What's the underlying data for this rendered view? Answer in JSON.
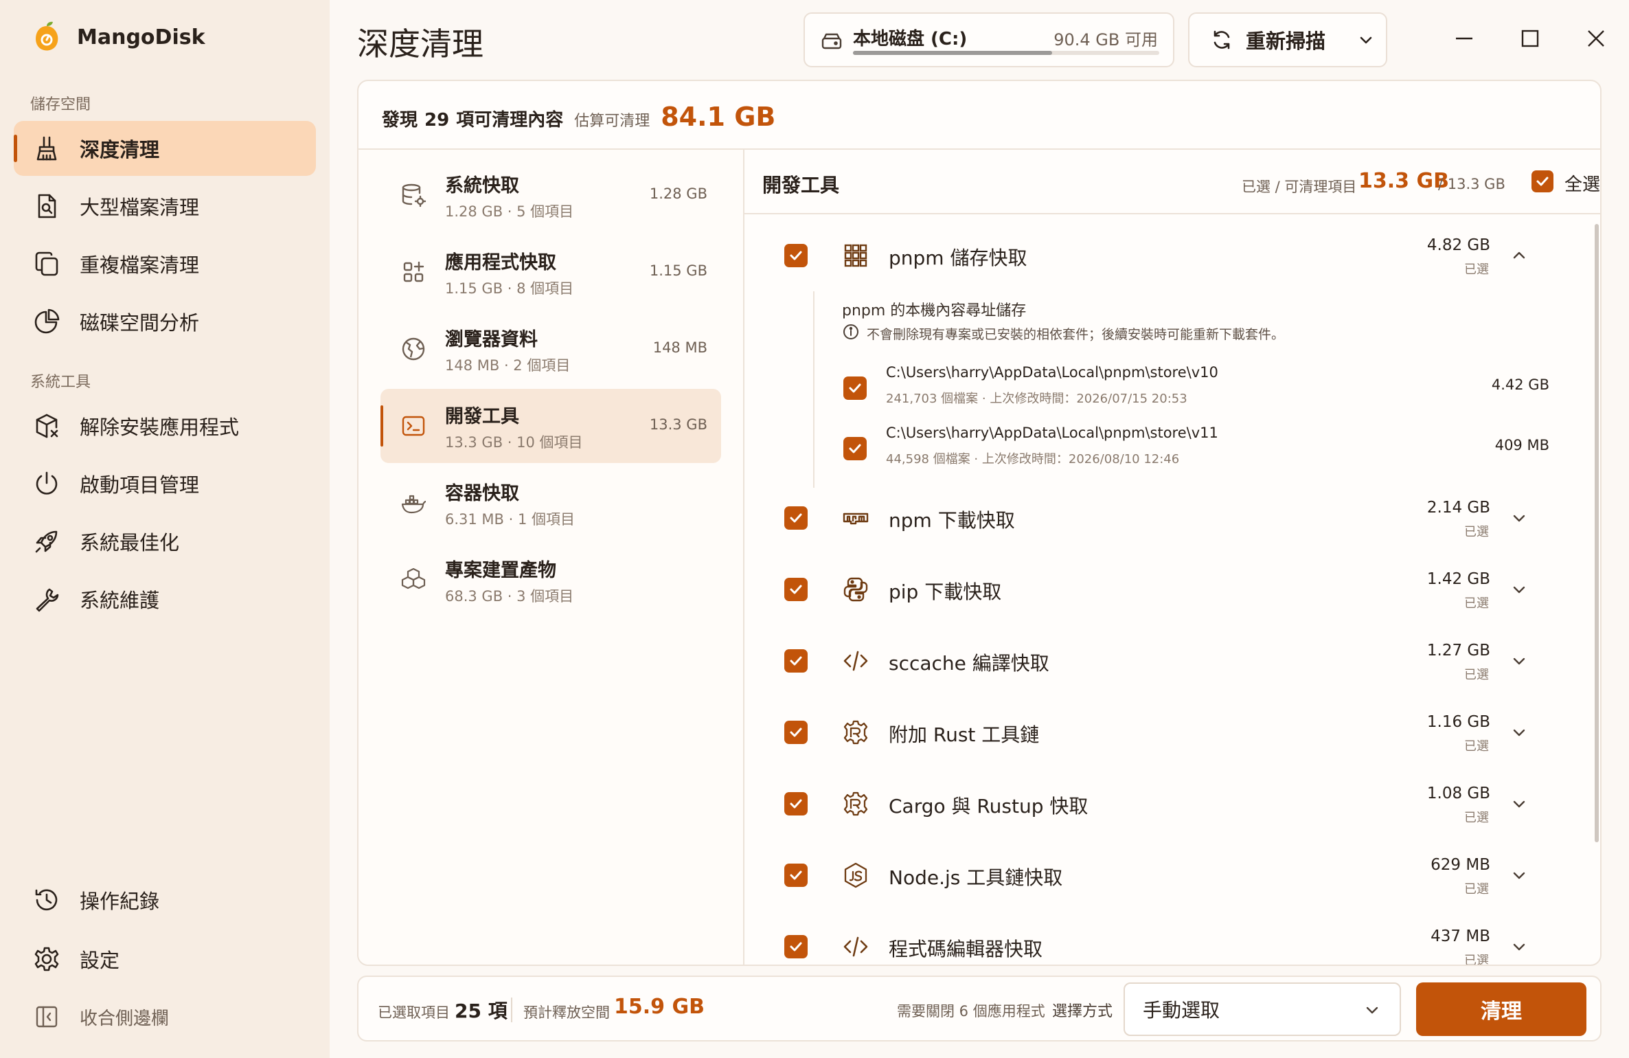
{
  "app": {
    "name": "MangoDisk"
  },
  "sidebar": {
    "section_storage": "儲存空間",
    "section_tools": "系統工具",
    "items": [
      {
        "label": "深度清理",
        "icon": "broom-icon",
        "active": true
      },
      {
        "label": "大型檔案清理",
        "icon": "file-search-icon"
      },
      {
        "label": "重複檔案清理",
        "icon": "copy-icon"
      },
      {
        "label": "磁碟空間分析",
        "icon": "pie-chart-icon"
      },
      {
        "label": "解除安裝應用程式",
        "icon": "package-remove-icon"
      },
      {
        "label": "啟動項目管理",
        "icon": "power-icon"
      },
      {
        "label": "系統最佳化",
        "icon": "rocket-icon"
      },
      {
        "label": "系統維護",
        "icon": "wrench-icon"
      }
    ],
    "bottom": [
      {
        "label": "操作紀錄",
        "icon": "history-icon"
      },
      {
        "label": "設定",
        "icon": "gear-icon"
      },
      {
        "label": "收合側邊欄",
        "icon": "collapse-sidebar-icon"
      }
    ]
  },
  "header": {
    "title": "深度清理",
    "disk_label": "本地磁盘 (C:)",
    "disk_free": "90.4 GB 可用",
    "disk_used_fraction": 0.65,
    "rescan_label": "重新掃描"
  },
  "summary": {
    "found_prefix": "發現",
    "found_count": "29",
    "found_suffix": "項可清理內容",
    "estimate_label": "估算可清理",
    "estimate_value": "84.1 GB"
  },
  "categories": [
    {
      "name": "系統快取",
      "sub": "1.28 GB · 5 個項目",
      "size": "1.28 GB",
      "icon": "database-gear-icon"
    },
    {
      "name": "應用程式快取",
      "sub": "1.15 GB · 8 個項目",
      "size": "1.15 GB",
      "icon": "apps-add-icon"
    },
    {
      "name": "瀏覽器資料",
      "sub": "148 MB · 2 個項目",
      "size": "148 MB",
      "icon": "globe-icon"
    },
    {
      "name": "開發工具",
      "sub": "13.3 GB · 10 個項目",
      "size": "13.3 GB",
      "icon": "terminal-icon",
      "active": true
    },
    {
      "name": "容器快取",
      "sub": "6.31 MB · 1 個項目",
      "size": "",
      "icon": "docker-icon"
    },
    {
      "name": "專案建置產物",
      "sub": "68.3 GB · 3 個項目",
      "size": "",
      "icon": "cubes-icon"
    }
  ],
  "detail": {
    "title": "開發工具",
    "selected_label": "已選 / 可清理項目",
    "selected_value": "13.3 GB",
    "total_value": "/ 13.3 GB",
    "select_all_label": "全選",
    "selected_tag": "已選",
    "expanded": {
      "name": "pnpm 儲存快取",
      "size": "4.82 GB",
      "desc": "pnpm 的本機內容尋址儲存",
      "note": "不會刪除現有專案或已安裝的相依套件；後續安裝時可能重新下載套件。",
      "paths": [
        {
          "path": "C:\\Users\\harry\\AppData\\Local\\pnpm\\store\\v10",
          "meta": "241,703 個檔案 · 上次修改時間：2026/07/15 20:53",
          "size": "4.42 GB"
        },
        {
          "path": "C:\\Users\\harry\\AppData\\Local\\pnpm\\store\\v11",
          "meta": "44,598 個檔案 · 上次修改時間：2026/08/10 12:46",
          "size": "409 MB"
        }
      ]
    },
    "rows": [
      {
        "name": "npm 下載快取",
        "size": "2.14 GB",
        "icon": "npm-icon"
      },
      {
        "name": "pip 下載快取",
        "size": "1.42 GB",
        "icon": "python-icon"
      },
      {
        "name": "sccache 編譯快取",
        "size": "1.27 GB",
        "icon": "code-icon"
      },
      {
        "name": "附加 Rust 工具鏈",
        "size": "1.16 GB",
        "icon": "rust-gear-icon"
      },
      {
        "name": "Cargo 與 Rustup 快取",
        "size": "1.08 GB",
        "icon": "rust-gear-icon"
      },
      {
        "name": "Node.js 工具鏈快取",
        "size": "629 MB",
        "icon": "nodejs-icon"
      },
      {
        "name": "程式碼編輯器快取",
        "size": "437 MB",
        "icon": "code-icon"
      }
    ]
  },
  "footer": {
    "selected_label": "已選取項目",
    "selected_count": "25 項",
    "release_label": "預計釋放空間",
    "release_value": "15.9 GB",
    "close_apps_note": "需要關閉 6 個應用程式",
    "mode_label": "選擇方式",
    "mode_value": "手動選取",
    "clean_button": "清理"
  },
  "colors": {
    "accent": "#c2540a",
    "sidebar_bg": "#f7ede3",
    "active_bg": "#fbd7b7"
  }
}
